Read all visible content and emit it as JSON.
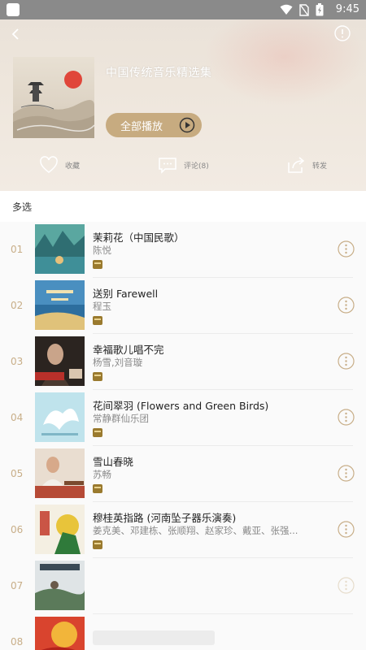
{
  "status_bar": {
    "time": "9:45"
  },
  "album": {
    "title": "中国传统音乐精选集",
    "play_all_label": "全部播放"
  },
  "actions": {
    "favorite_label": "收藏",
    "comment_label": "评论(8)",
    "share_label": "转发"
  },
  "multiselect_label": "多选",
  "tracks": [
    {
      "num": "01",
      "title": "茉莉花（中国民歌）",
      "artist": "陈悦"
    },
    {
      "num": "02",
      "title": "送别 Farewell",
      "artist": "程玉"
    },
    {
      "num": "03",
      "title": "幸福歌儿唱不完",
      "artist": "杨雪,刘音璇"
    },
    {
      "num": "04",
      "title": "花间翠羽 (Flowers and Green Birds)",
      "artist": "常静群仙乐团"
    },
    {
      "num": "05",
      "title": "雪山春晓",
      "artist": "苏畅"
    },
    {
      "num": "06",
      "title": "穆桂英指路 (河南坠子器乐演奏)",
      "artist": "姜克美、邓建栋、张顺翔、赵家珍、戴亚、张强..."
    },
    {
      "num": "07",
      "title": "",
      "artist": ""
    },
    {
      "num": "08",
      "title": "",
      "artist": ""
    }
  ],
  "colors": {
    "accent": "#c7ab80",
    "track_number": "#c8ae88",
    "hq_badge": "#9a7a2e"
  }
}
